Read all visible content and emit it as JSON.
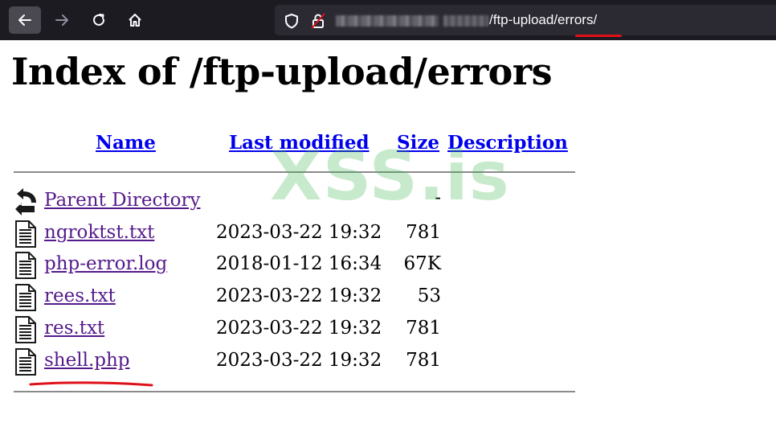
{
  "browser": {
    "url_visible": "/ftp-upload/errors/",
    "accent_color": "#e0101a",
    "icons": [
      "back-icon",
      "forward-icon",
      "reload-icon",
      "home-icon",
      "shield-icon",
      "lock-icon"
    ]
  },
  "page": {
    "title": "Index of /ftp-upload/errors"
  },
  "table": {
    "headers": {
      "name": "Name",
      "modified": "Last modified",
      "size": "Size",
      "description": "Description"
    },
    "parent": {
      "label": "Parent Directory",
      "size": "-"
    },
    "rows": [
      {
        "name": "ngroktst.txt",
        "modified": "2023-03-22 19:32",
        "size": "781"
      },
      {
        "name": "php-error.log",
        "modified": "2018-01-12 16:34",
        "size": "67K"
      },
      {
        "name": "rees.txt",
        "modified": "2023-03-22 19:32",
        "size": "53"
      },
      {
        "name": "res.txt",
        "modified": "2023-03-22 19:32",
        "size": "781"
      },
      {
        "name": "shell.php",
        "modified": "2023-03-22 19:32",
        "size": "781"
      }
    ]
  },
  "watermark": "XSS.is",
  "colors": {
    "link": "#0000ee",
    "visited_link": "#551a8b",
    "annotation": "#e0101a"
  }
}
